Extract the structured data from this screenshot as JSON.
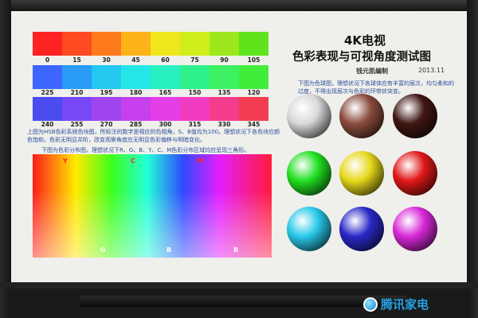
{
  "chart_title": {
    "line1": "4K电视",
    "line2": "色彩表现与可视角度测试图",
    "credit": "钱元凯编制",
    "date": "2013.11"
  },
  "hue_strips": [
    {
      "labels": [
        "0",
        "15",
        "30",
        "45",
        "60",
        "75",
        "90",
        "105"
      ],
      "colors": [
        "#ff2222",
        "#ff4a22",
        "#ff7a1c",
        "#ffb31a",
        "#f0e61c",
        "#cfee1c",
        "#9de81c",
        "#5fe41c"
      ]
    },
    {
      "labels": [
        "225",
        "210",
        "195",
        "180",
        "165",
        "150",
        "135",
        "120"
      ],
      "colors": [
        "#3c66ff",
        "#2a9bf6",
        "#22c8f0",
        "#25e6e6",
        "#28f0c0",
        "#2ef08c",
        "#3cf062",
        "#40ee3a"
      ]
    },
    {
      "labels": [
        "240",
        "255",
        "270",
        "285",
        "300",
        "315",
        "330",
        "345"
      ],
      "colors": [
        "#4a4cf0",
        "#7848f6",
        "#a044f0",
        "#c640ee",
        "#e43ee6",
        "#f23cc0",
        "#f43c8c",
        "#f43c50"
      ]
    }
  ],
  "descriptions": {
    "hue": "上图为HSB色彩系统色块图，所标注的数字是相应的色相角，S、B值均为100。理想状况下各色块应颜色饱和，色彩无明显并阶，改变观察角度应无明显色彩偏移与明暗变化。",
    "gamut": "下图为色彩分布图，理想状况下R、G、B、Y、C、M色彩分布区域均应呈现三角形。",
    "spheres": "下图为色球图，理想状况下各球体应有丰富的层次，均匀柔和的过度，不得出现层次与色彩的环带状突变。"
  },
  "gamut_labels": {
    "top": [
      "Y",
      "C",
      "M"
    ],
    "bottom": [
      "G",
      "B",
      "R"
    ]
  },
  "spheres": [
    [
      "#d9d9dc",
      "#8a4c3c",
      "#3f1712"
    ],
    [
      "#22e022",
      "#e6d81a",
      "#e01818"
    ],
    [
      "#28c8e8",
      "#2a28c8",
      "#d828d8"
    ]
  ],
  "brand": {
    "logo_text": "腾讯家电",
    "accent": "#26a0e0"
  }
}
